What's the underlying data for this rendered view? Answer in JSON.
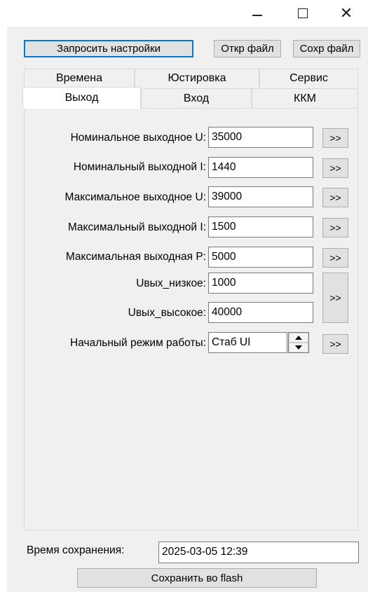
{
  "window": {
    "minimize_icon": "minimize-icon",
    "maximize_icon": "maximize-icon",
    "close_symbol": "✕"
  },
  "toolbar": {
    "request_settings": "Запросить настройки",
    "open_file": "Откр файл",
    "save_file": "Сохр файл"
  },
  "tabs": {
    "row1": [
      "Времена",
      "Юстировка",
      "Сервис"
    ],
    "row2": [
      "Выход",
      "Вход",
      "ККМ"
    ],
    "active": "Выход"
  },
  "form": {
    "fields": [
      {
        "label": "Номинальное выходное U:",
        "value": "35000"
      },
      {
        "label": "Номинальный выходной I:",
        "value": "1440"
      },
      {
        "label": "Максимальное выходное U:",
        "value": "39000"
      },
      {
        "label": "Максимальный выходной I:",
        "value": "1500"
      },
      {
        "label": "Максимальная выходная P:",
        "value": "5000"
      },
      {
        "label": "Uвых_низкое:",
        "value": "1000"
      },
      {
        "label": "Uвых_высокое:",
        "value": "40000"
      },
      {
        "label": "Начальный режим работы:",
        "value": "Стаб UI"
      }
    ],
    "send_label": ">>"
  },
  "footer": {
    "save_time_label": "Время сохранения:",
    "save_time_value": "2025-03-05 12:39",
    "save_flash": "Сохранить во flash"
  },
  "colors": {
    "focus_border": "#0078d7",
    "button_face": "#e1e1e1",
    "background": "#f0f0f0"
  }
}
